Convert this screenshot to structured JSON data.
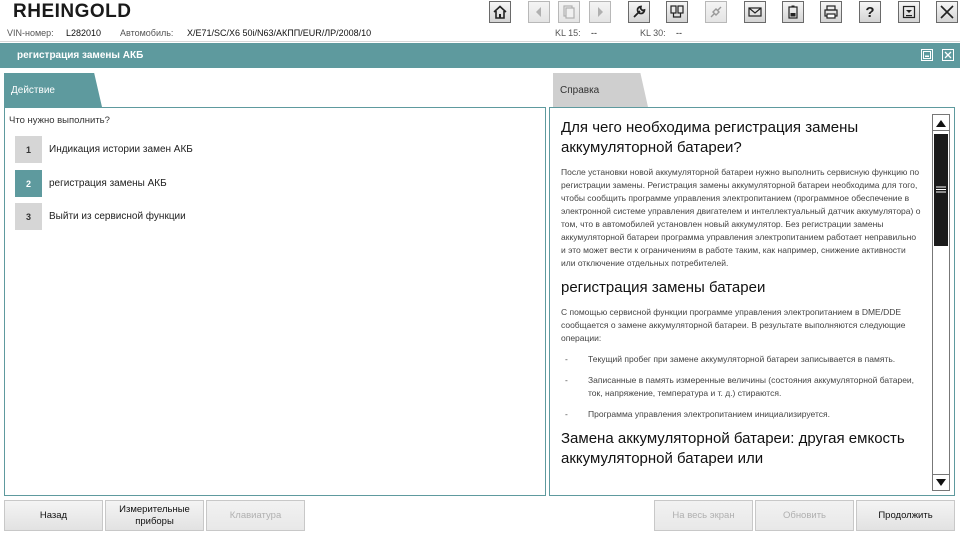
{
  "app": {
    "title": "RHEINGOLD"
  },
  "toolbar": {
    "buttons": [
      {
        "icon": "home-icon",
        "enabled": true
      },
      {
        "icon": "arrow-left-icon",
        "enabled": false
      },
      {
        "icon": "document-stack-icon",
        "enabled": false
      },
      {
        "icon": "arrow-right-icon",
        "enabled": false
      },
      {
        "icon": "wrench-icon",
        "enabled": true
      },
      {
        "icon": "diagnosis-device-icon",
        "enabled": true
      },
      {
        "icon": "connection-icon",
        "enabled": false
      },
      {
        "icon": "mail-icon",
        "enabled": true
      },
      {
        "icon": "battery-icon",
        "enabled": true
      },
      {
        "icon": "printer-icon",
        "enabled": true
      },
      {
        "icon": "help-icon",
        "enabled": true
      },
      {
        "icon": "minimize-icon",
        "enabled": true
      },
      {
        "icon": "close-icon",
        "enabled": true
      }
    ],
    "help_symbol": "?"
  },
  "vehicle": {
    "vin_label": "VIN-номер:",
    "vin_value": "L282010",
    "car_label": "Автомобиль:",
    "car_value": "X/E71/SC/X6 50i/N63/АКПП/EUR/ЛР/2008/10",
    "kl15_label": "KL 15:",
    "kl15_value": "--",
    "kl30_label": "KL 30:",
    "kl30_value": "--"
  },
  "window": {
    "title": "регистрация замены АКБ"
  },
  "tabs": {
    "action": "Действие",
    "help": "Справка"
  },
  "action_panel": {
    "question": "Что нужно выполнить?",
    "options": [
      {
        "num": "1",
        "label": "Индикация истории замен АКБ",
        "active": false
      },
      {
        "num": "2",
        "label": "регистрация замены АКБ",
        "active": true
      },
      {
        "num": "3",
        "label": "Выйти из сервисной функции",
        "active": false
      }
    ]
  },
  "help_panel": {
    "heading1": "Для чего необходима регистрация замены аккумуляторной батареи?",
    "para1": "После установки новой аккумуляторной батареи нужно выполнить сервисную функцию по регистрации замены. Регистрация замены аккумуляторной батареи необходима для того, чтобы сообщить программе управления электропитанием (программное обеспечение в электронной системе управления двигателем и интеллектуальный датчик аккумулятора) о том, что в автомобилей установлен новый аккумулятор. Без регистрации замены аккумуляторной батареи программа управления электропитанием работает неправильно и это может вести к ограничениям в работе таким, как например, снижение активности или отключение отдельных потребителей.",
    "heading2": "регистрация замены батареи",
    "para2": "С помощью сервисной функции программе управления электропитанием в DME/DDE сообщается о замене аккумуляторной батареи. В результате выполняются следующие операции:",
    "list": [
      "Текущий пробег при замене аккумуляторной батареи записывается в память.",
      "Записанные в память измеренные величины (состояния аккумуляторной батареи, ток, напряжение, температура и т. д.) стираются.",
      "Программа управления электропитанием инициализируется."
    ],
    "heading3": "Замена аккумуляторной батареи: другая емкость аккумуляторной батареи или"
  },
  "bottom": {
    "back": "Назад",
    "meters": "Измерительные приборы",
    "keyboard": "Клавиатура",
    "fullscreen": "На весь экран",
    "refresh": "Обновить",
    "continue": "Продолжить"
  },
  "colors": {
    "accent": "#5e9a9e",
    "inactive_tab": "#cfcfcf"
  }
}
